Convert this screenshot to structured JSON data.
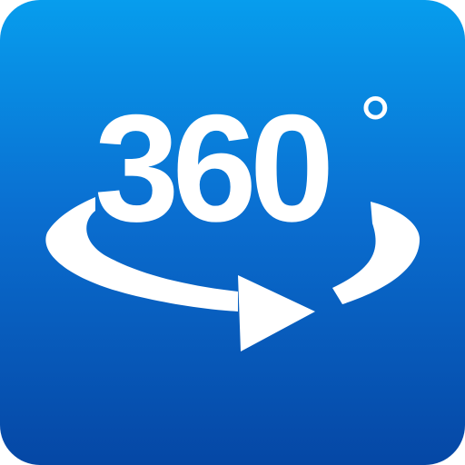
{
  "icon": {
    "label_number": "360",
    "label_unit": "°",
    "symbol": "rotate-360-arrow-icon",
    "gradient_top_color": "#079ded",
    "gradient_bottom_color": "#0547a5",
    "foreground_color": "#ffffff"
  }
}
